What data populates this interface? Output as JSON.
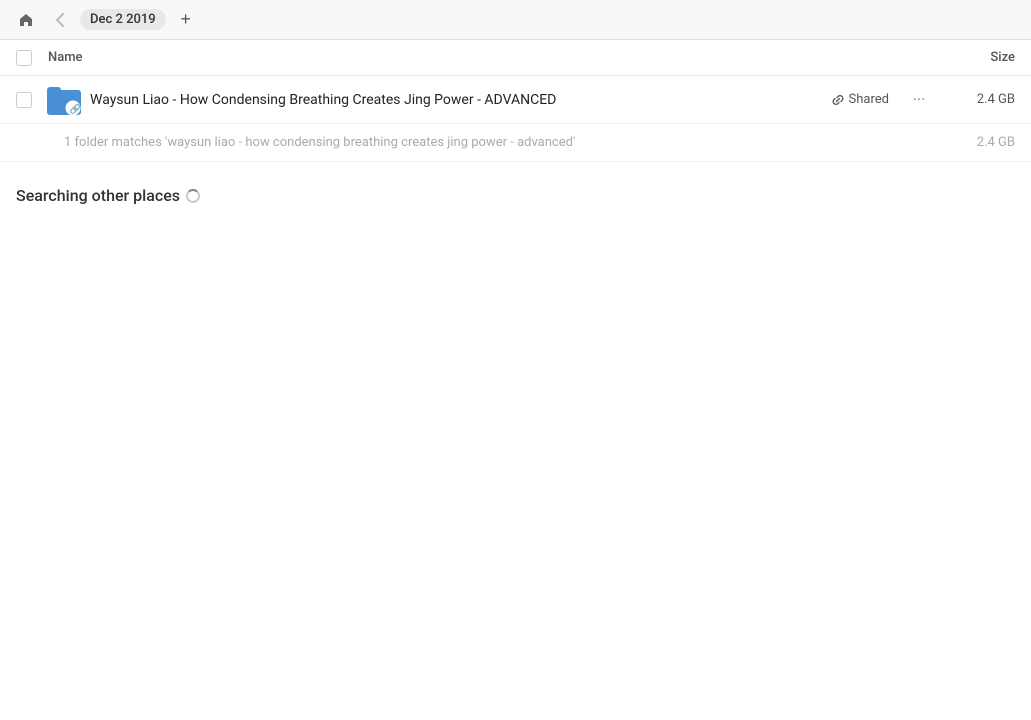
{
  "topbar": {
    "breadcrumb_label": "Dec 2 2019",
    "add_button_label": "+",
    "home_icon": "🏠",
    "back_icon": "‹"
  },
  "columns": {
    "name_label": "Name",
    "size_label": "Size"
  },
  "file_row": {
    "name": "Waysun Liao - How Condensing Breathing Creates Jing Power - ADVANCED",
    "shared_label": "Shared",
    "size": "2.4 GB",
    "more_icon": "···"
  },
  "match_row": {
    "text": "1 folder matches 'waysun liao - how condensing breathing creates jing power - advanced'",
    "size": "2.4 GB"
  },
  "searching_section": {
    "title": "Searching other places"
  }
}
